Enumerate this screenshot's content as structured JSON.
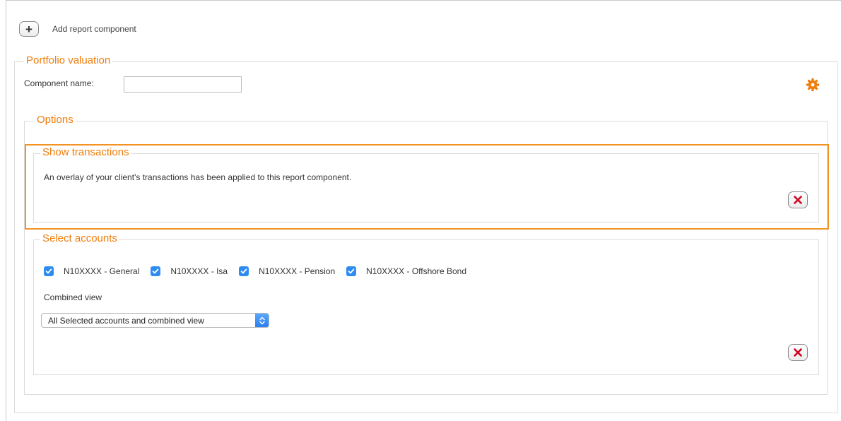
{
  "toolbar": {
    "add_label": "Add report component",
    "add_symbol": "+"
  },
  "portfolio": {
    "legend": "Portfolio valuation",
    "component_name_label": "Component name:",
    "component_name_value": "",
    "settings_icon": "gear-icon"
  },
  "options": {
    "legend": "Options"
  },
  "transactions": {
    "legend": "Show transactions",
    "message": "An overlay of your client's transactions has been applied to this report component."
  },
  "accounts": {
    "legend": "Select accounts",
    "items": [
      {
        "label": "N10XXXX - General",
        "checked": true
      },
      {
        "label": "N10XXXX - Isa",
        "checked": true
      },
      {
        "label": "N10XXXX - Pension",
        "checked": true
      },
      {
        "label": "N10XXXX - Offshore Bond",
        "checked": true
      }
    ],
    "combined_view_label": "Combined view",
    "combined_view_selected": "All Selected accounts and combined view"
  },
  "colors": {
    "accent": "#f07d0b",
    "highlight_border": "#f39323",
    "checkbox": "#2e8cf0",
    "remove_icon": "#d0021b"
  }
}
